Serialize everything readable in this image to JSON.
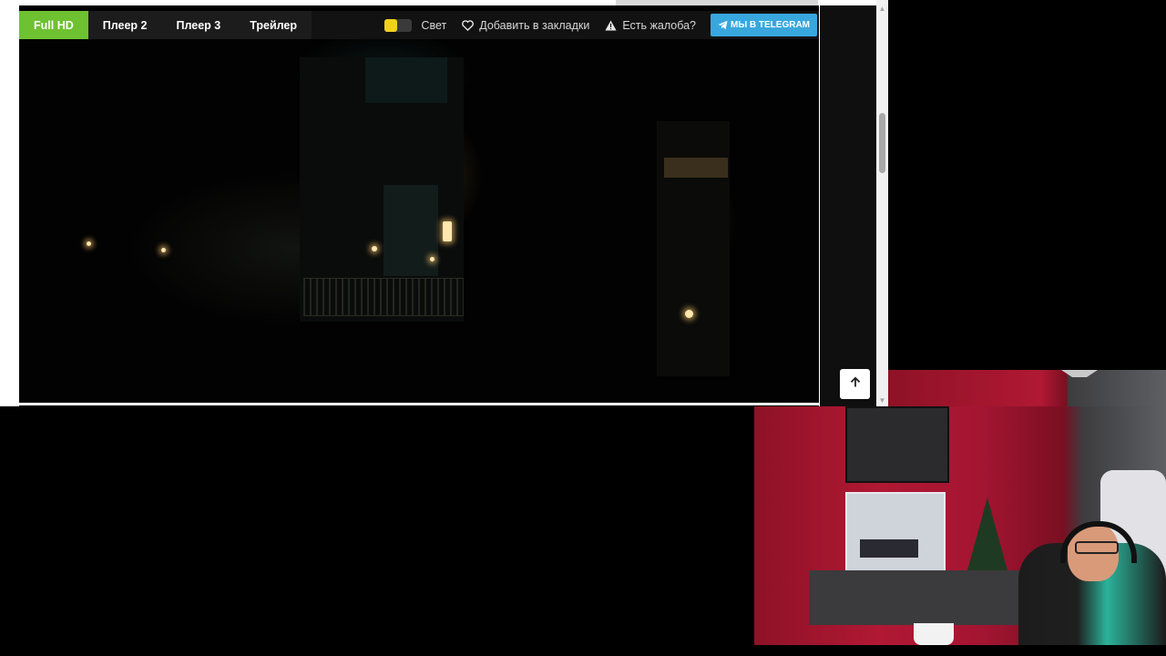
{
  "player": {
    "tabs": [
      {
        "label": "Full HD",
        "active": true
      },
      {
        "label": "Плеер 2",
        "active": false
      },
      {
        "label": "Плеер 3",
        "active": false
      },
      {
        "label": "Трейлер",
        "active": false
      }
    ],
    "light_toggle": {
      "label": "Свет",
      "color": "#f1d21a"
    },
    "bookmark_label": "Добавить в закладки",
    "complaint_label": "Есть жалоба?",
    "telegram_label": "МЫ В TELEGRAM",
    "colors": {
      "active_tab": "#6ec131",
      "telegram": "#38a7dd",
      "bar": "#121212"
    }
  },
  "icons": {
    "bookmark": "heart-icon",
    "complaint": "warning-icon",
    "telegram": "paper-plane-icon",
    "scroll_top": "arrow-up-icon"
  }
}
